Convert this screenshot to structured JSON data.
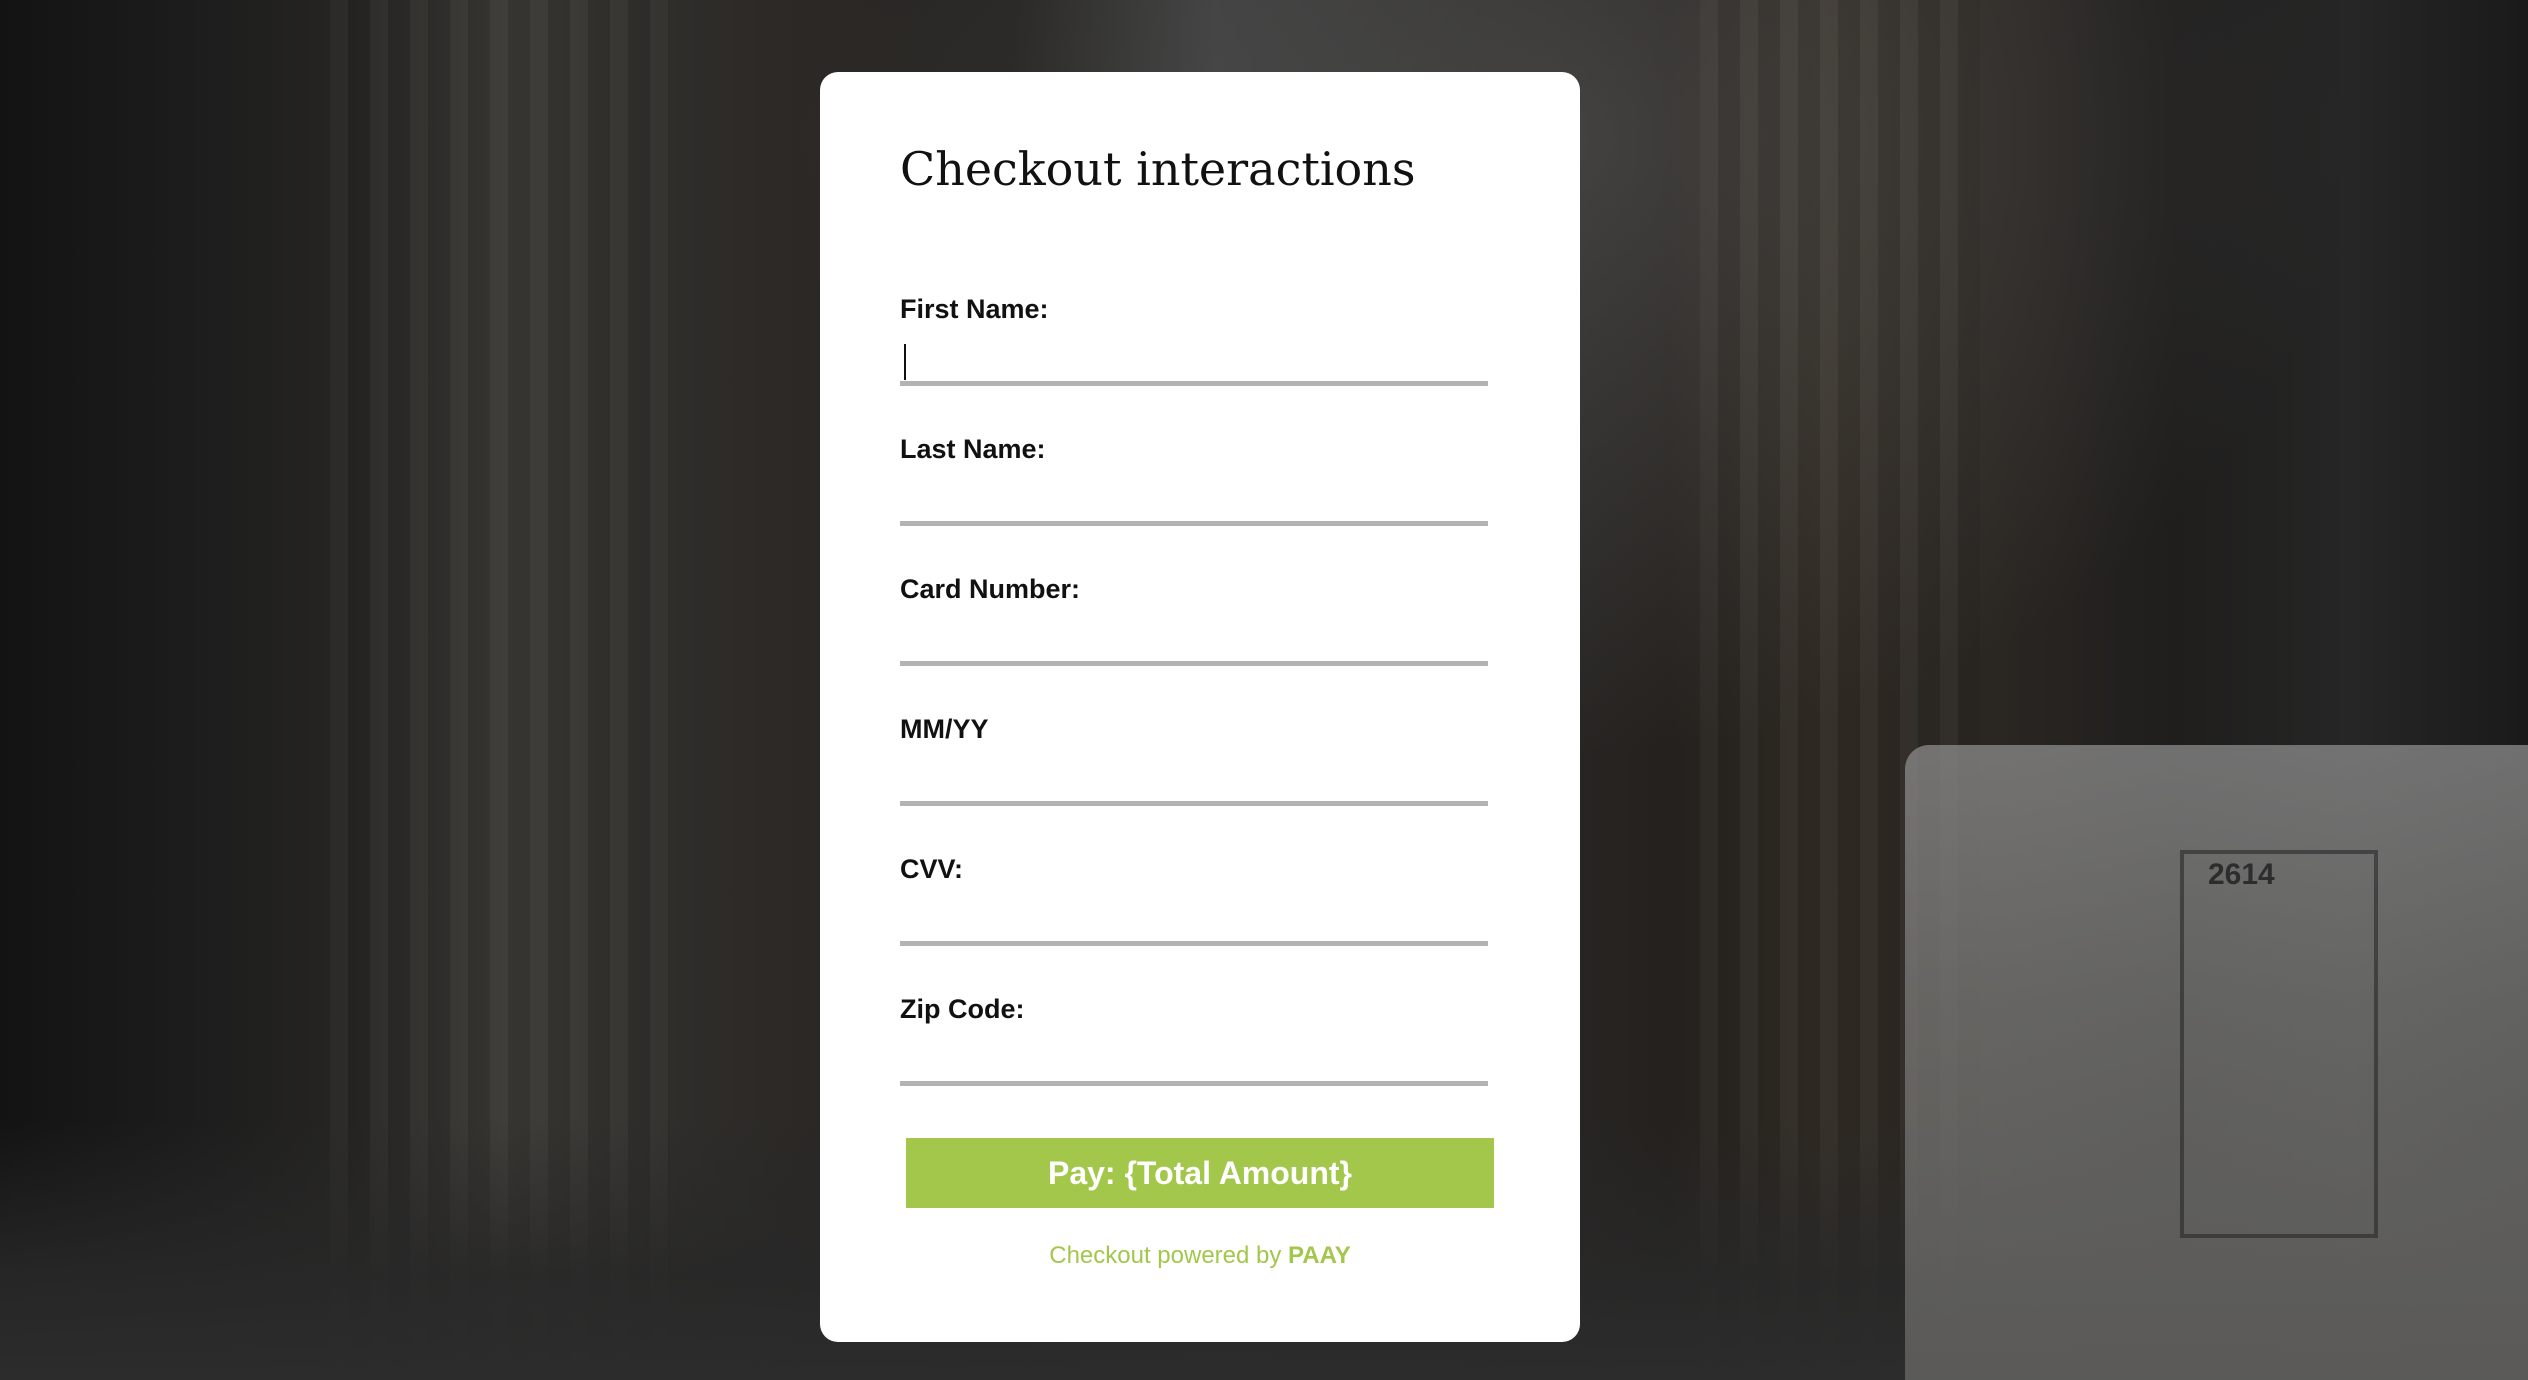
{
  "checkout": {
    "title": "Checkout interactions",
    "fields": [
      {
        "label": "First Name:",
        "value": "",
        "placeholder": ""
      },
      {
        "label": "Last Name:",
        "value": "",
        "placeholder": ""
      },
      {
        "label": "Card Number:",
        "value": "",
        "placeholder": ""
      },
      {
        "label": "MM/YY",
        "value": "",
        "placeholder": ""
      },
      {
        "label": "CVV:",
        "value": "",
        "placeholder": ""
      },
      {
        "label": "Zip Code:",
        "value": "",
        "placeholder": ""
      }
    ],
    "pay_button": "Pay: {Total Amount}",
    "powered_prefix": "Checkout powered by ",
    "powered_brand": "PAAY"
  },
  "background": {
    "truck_number": "2614"
  },
  "colors": {
    "accent": "#a3c74a",
    "card": "#ffffff",
    "underline": "#b3b3b3",
    "text": "#111111"
  }
}
